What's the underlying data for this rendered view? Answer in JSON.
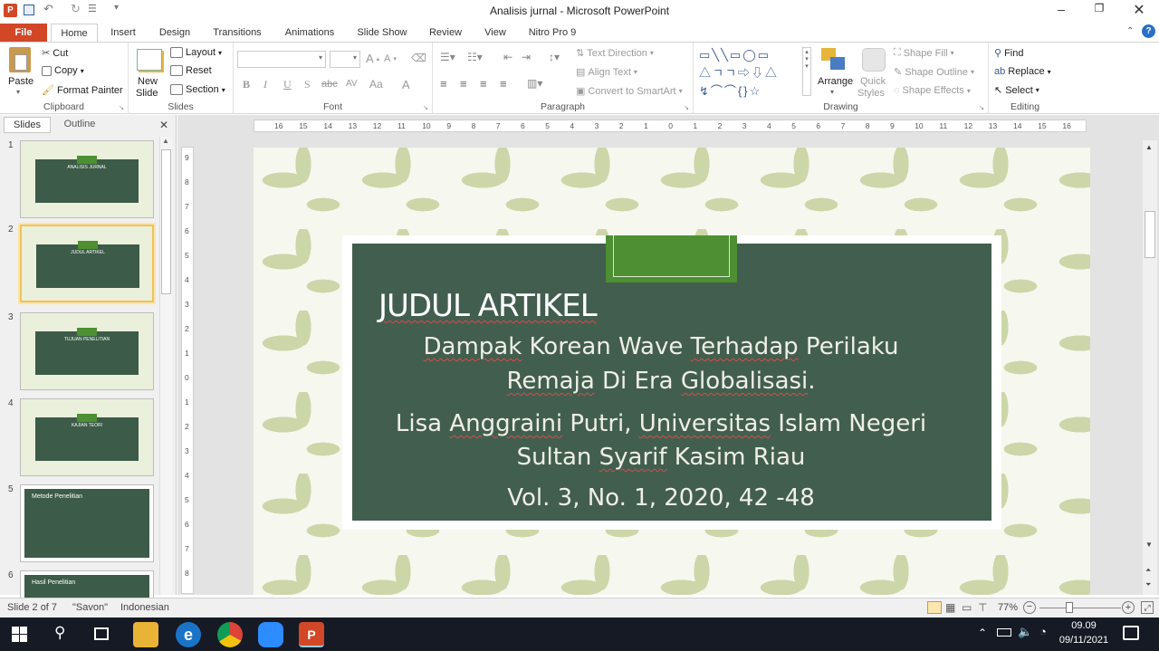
{
  "window": {
    "title": "Analisis jurnal  -  Microsoft PowerPoint"
  },
  "tabs": [
    {
      "label": "File"
    },
    {
      "label": "Home"
    },
    {
      "label": "Insert"
    },
    {
      "label": "Design"
    },
    {
      "label": "Transitions"
    },
    {
      "label": "Animations"
    },
    {
      "label": "Slide Show"
    },
    {
      "label": "Review"
    },
    {
      "label": "View"
    },
    {
      "label": "Nitro Pro 9"
    }
  ],
  "ribbon": {
    "clipboard": {
      "paste": "Paste",
      "cut": "Cut",
      "copy": "Copy",
      "format_painter": "Format Painter",
      "label": "Clipboard"
    },
    "slides": {
      "new_slide": "New",
      "new_slide2": "Slide",
      "layout": "Layout",
      "reset": "Reset",
      "section": "Section",
      "label": "Slides"
    },
    "font": {
      "label": "Font",
      "size_grow": "A",
      "size_shrink": "A",
      "bold": "B",
      "italic": "I",
      "underline": "U",
      "shadow": "S",
      "strike": "abc",
      "spacing": "AV",
      "case": "Aa",
      "color": "A"
    },
    "paragraph": {
      "label": "Paragraph",
      "text_direction": "Text Direction",
      "align_text": "Align Text",
      "smartart": "Convert to SmartArt"
    },
    "drawing": {
      "label": "Drawing",
      "arrange": "Arrange",
      "quick_styles": "Quick",
      "quick_styles2": "Styles",
      "shape_fill": "Shape Fill",
      "shape_outline": "Shape Outline",
      "shape_effects": "Shape Effects"
    },
    "editing": {
      "label": "Editing",
      "find": "Find",
      "replace": "Replace",
      "select": "Select"
    }
  },
  "panel": {
    "slides_tab": "Slides",
    "outline_tab": "Outline"
  },
  "thumbnails": [
    {
      "num": "1",
      "text": "ANALISIS JURNAL"
    },
    {
      "num": "2",
      "text": "JUDUL ARTIKEL"
    },
    {
      "num": "3",
      "text": "TUJUAN PENELITIAN"
    },
    {
      "num": "4",
      "text": "KAJIAN TEORI"
    },
    {
      "num": "5",
      "text": "Metode Penelitian"
    },
    {
      "num": "6",
      "text": "Hasil Penelitian"
    }
  ],
  "slide": {
    "title": "JUDUL ARTIKEL",
    "line1": "Dampak Korean Wave Terhadap Perilaku",
    "line2": "Remaja Di Era Globalisasi.",
    "line3": "Lisa Anggraini Putri, Universitas Islam Negeri",
    "line4": "Sultan Syarif Kasim Riau",
    "line5": "Vol. 3, No. 1, 2020, 42 -48"
  },
  "status": {
    "slide": "Slide 2 of 7",
    "theme": "\"Savon\"",
    "language": "Indonesian",
    "zoom": "77%"
  },
  "taskbar": {
    "time": "09.09",
    "date": "09/11/2021"
  },
  "ruler_h": [
    "16",
    "15",
    "14",
    "13",
    "12",
    "11",
    "10",
    "9",
    "8",
    "7",
    "6",
    "5",
    "4",
    "3",
    "2",
    "1",
    "0",
    "1",
    "2",
    "3",
    "4",
    "5",
    "6",
    "7",
    "8",
    "9",
    "10",
    "11",
    "12",
    "13",
    "14",
    "15",
    "16"
  ],
  "ruler_v": [
    "9",
    "8",
    "7",
    "6",
    "5",
    "4",
    "3",
    "2",
    "1",
    "0",
    "1",
    "2",
    "3",
    "4",
    "5",
    "6",
    "7",
    "8"
  ]
}
